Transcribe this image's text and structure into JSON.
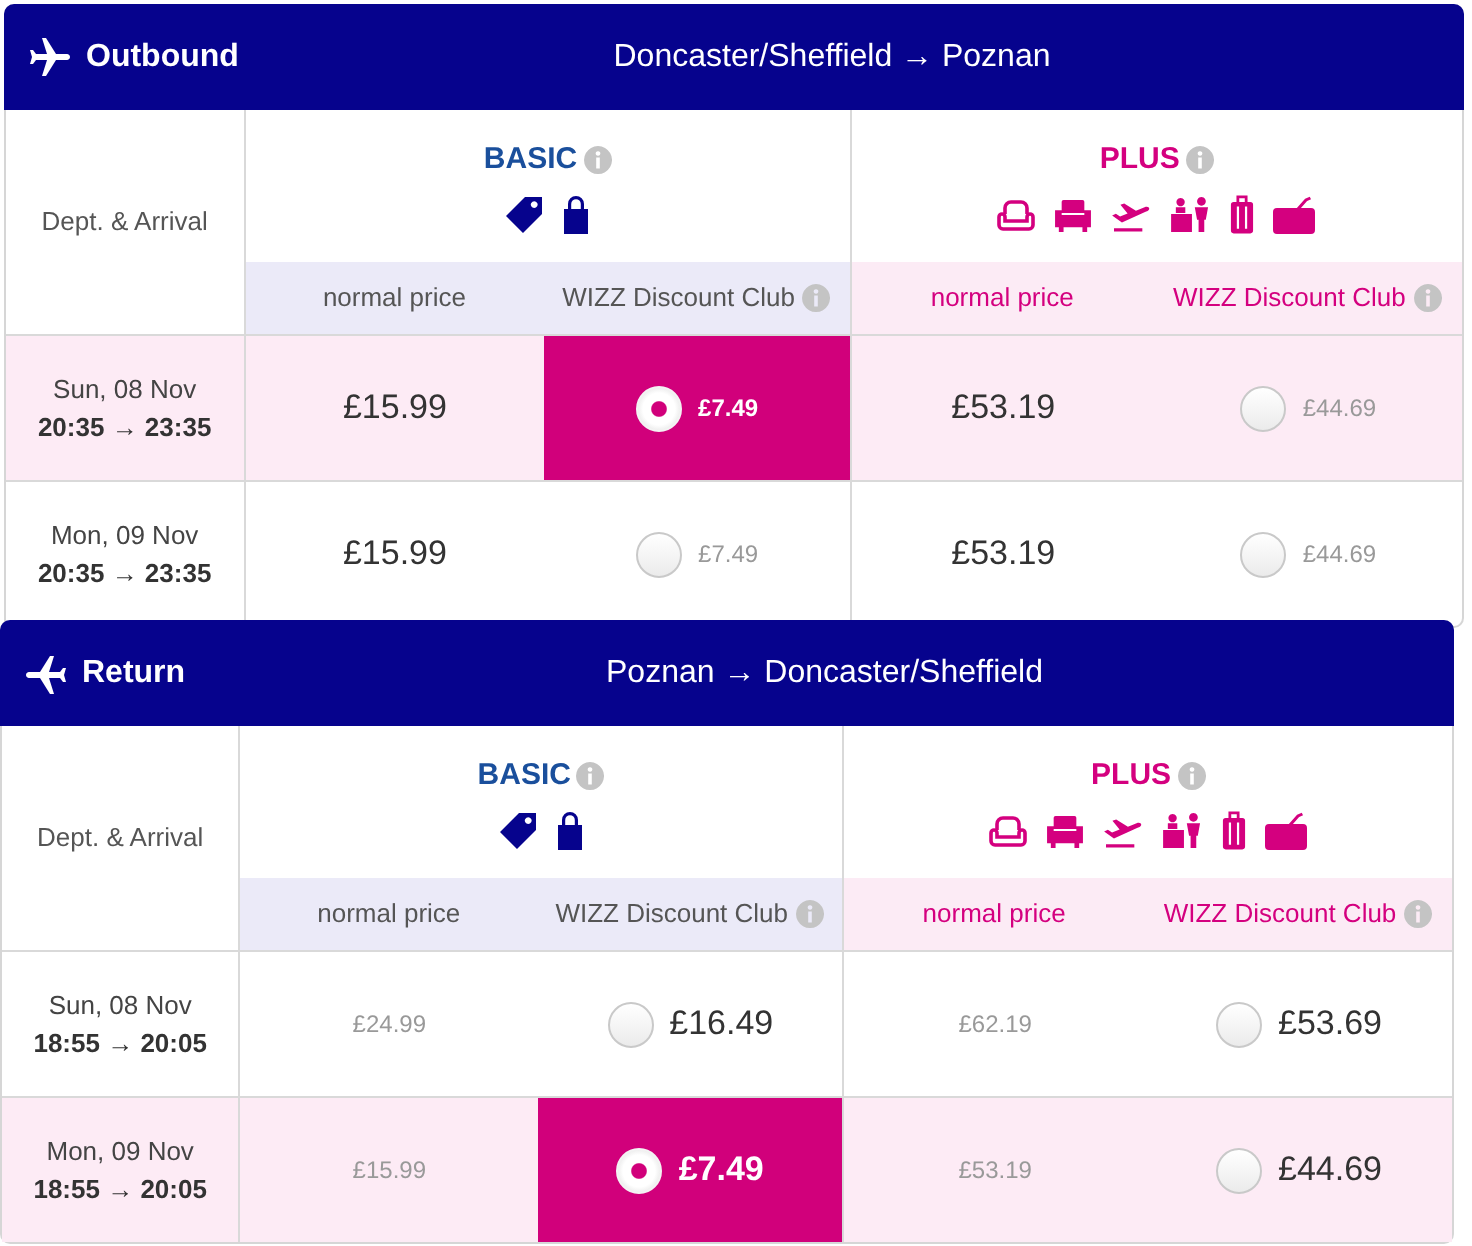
{
  "flights": [
    {
      "kind": "outbound",
      "title": "Outbound",
      "route": "Doncaster/Sheffield → Poznan",
      "time_column_label": "Dept. & Arrival",
      "tiers": [
        {
          "kind": "basic",
          "name": "BASIC",
          "fare_types": [
            {
              "kind": "normal",
              "label": "normal price"
            },
            {
              "kind": "club",
              "label": "WIZZ Discount Club"
            }
          ]
        },
        {
          "kind": "plus",
          "name": "PLUS",
          "fare_types": [
            {
              "kind": "normal",
              "label": "normal price"
            },
            {
              "kind": "club",
              "label": "WIZZ Discount Club"
            }
          ]
        }
      ],
      "rows": [
        {
          "date": "Sun, 08 Nov",
          "times": "20:35 → 23:35",
          "fares": [
            {
              "normal": {
                "price": "£15.99",
                "emphasized": true
              },
              "club": {
                "price": "£7.49",
                "emphasized": false,
                "selected": true
              }
            },
            {
              "normal": {
                "price": "£53.19",
                "emphasized": true
              },
              "club": {
                "price": "£44.69",
                "emphasized": false,
                "selected": false
              }
            }
          ]
        },
        {
          "date": "Mon, 09 Nov",
          "times": "20:35 → 23:35",
          "fares": [
            {
              "normal": {
                "price": "£15.99",
                "emphasized": true
              },
              "club": {
                "price": "£7.49",
                "emphasized": false,
                "selected": false
              }
            },
            {
              "normal": {
                "price": "£53.19",
                "emphasized": true
              },
              "club": {
                "price": "£44.69",
                "emphasized": false,
                "selected": false
              }
            }
          ]
        }
      ]
    },
    {
      "kind": "return",
      "title": "Return",
      "route": "Poznan → Doncaster/Sheffield",
      "time_column_label": "Dept. & Arrival",
      "tiers": [
        {
          "kind": "basic",
          "name": "BASIC",
          "fare_types": [
            {
              "kind": "normal",
              "label": "normal price"
            },
            {
              "kind": "club",
              "label": "WIZZ Discount Club"
            }
          ]
        },
        {
          "kind": "plus",
          "name": "PLUS",
          "fare_types": [
            {
              "kind": "normal",
              "label": "normal price"
            },
            {
              "kind": "club",
              "label": "WIZZ Discount Club"
            }
          ]
        }
      ],
      "rows": [
        {
          "date": "Sun, 08 Nov",
          "times": "18:55 → 20:05",
          "fares": [
            {
              "normal": {
                "price": "£24.99",
                "emphasized": false
              },
              "club": {
                "price": "£16.49",
                "emphasized": true,
                "selected": false
              }
            },
            {
              "normal": {
                "price": "£62.19",
                "emphasized": false
              },
              "club": {
                "price": "£53.69",
                "emphasized": true,
                "selected": false
              }
            }
          ]
        },
        {
          "date": "Mon, 09 Nov",
          "times": "18:55 → 20:05",
          "fares": [
            {
              "normal": {
                "price": "£15.99",
                "emphasized": false
              },
              "club": {
                "price": "£7.49",
                "emphasized": true,
                "selected": true
              }
            },
            {
              "normal": {
                "price": "£53.19",
                "emphasized": false
              },
              "club": {
                "price": "£44.69",
                "emphasized": true,
                "selected": false
              }
            }
          ]
        }
      ]
    }
  ]
}
